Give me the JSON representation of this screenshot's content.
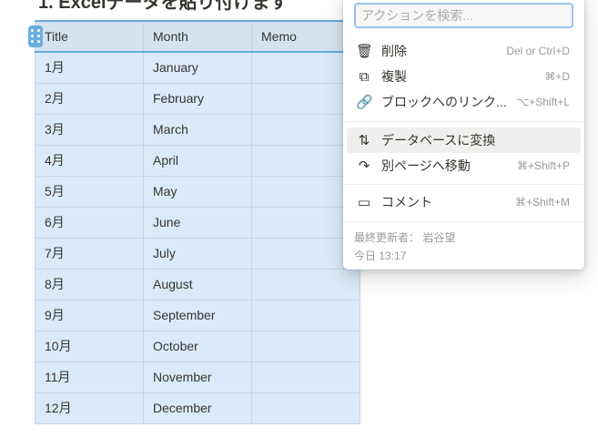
{
  "heading": "1. Excelデータを貼り付けます",
  "table": {
    "headers": [
      "Title",
      "Month",
      "Memo"
    ],
    "rows": [
      [
        "1月",
        "January",
        ""
      ],
      [
        "2月",
        "February",
        ""
      ],
      [
        "3月",
        "March",
        ""
      ],
      [
        "4月",
        "April",
        ""
      ],
      [
        "5月",
        "May",
        ""
      ],
      [
        "6月",
        "June",
        ""
      ],
      [
        "7月",
        "July",
        ""
      ],
      [
        "8月",
        "August",
        ""
      ],
      [
        "9月",
        "September",
        ""
      ],
      [
        "10月",
        "October",
        ""
      ],
      [
        "11月",
        "November",
        ""
      ],
      [
        "12月",
        "December",
        ""
      ]
    ]
  },
  "menu": {
    "search_placeholder": "アクションを検索...",
    "items": [
      {
        "icon": "trash-icon",
        "label": "削除",
        "shortcut": "Del or Ctrl+D"
      },
      {
        "icon": "duplicate-icon",
        "label": "複製",
        "shortcut": "⌘+D"
      },
      {
        "icon": "link-icon",
        "label": "ブロックへのリンク...",
        "shortcut": "⌥+Shift+L"
      },
      {
        "icon": "convert-icon",
        "label": "データベースに変換",
        "shortcut": ""
      },
      {
        "icon": "move-arrow-icon",
        "label": "別ページへ移動",
        "shortcut": "⌘+Shift+P"
      },
      {
        "icon": "comment-icon",
        "label": "コメント",
        "shortcut": "⌘+Shift+M"
      }
    ],
    "last_edited_by": "最終更新者： 岩谷望",
    "last_edited_time": "今日 13:17"
  }
}
